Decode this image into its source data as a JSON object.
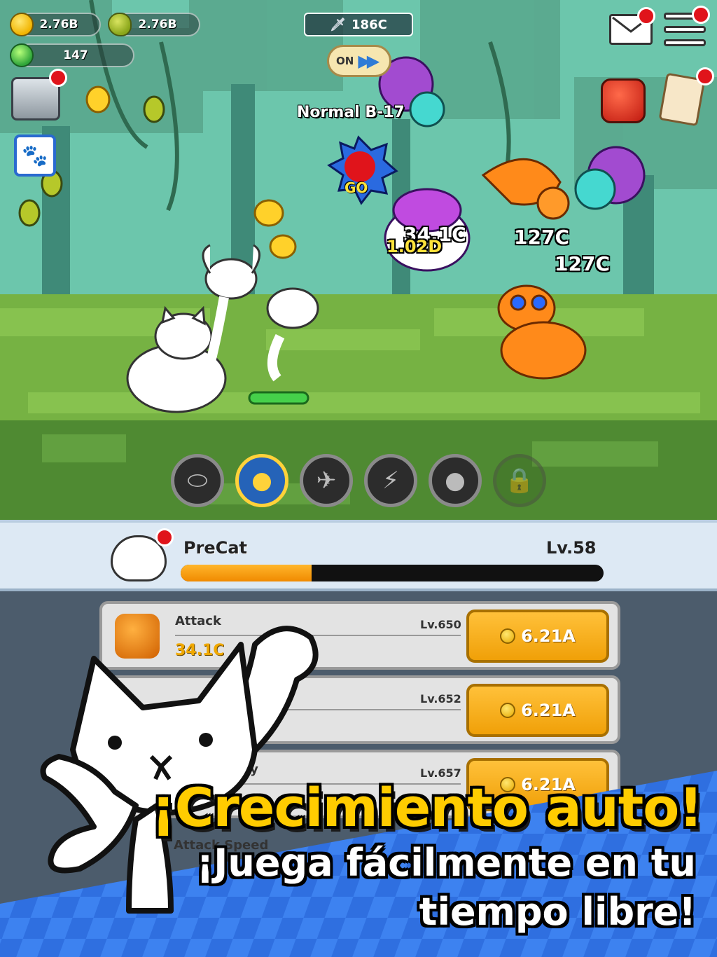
{
  "hud": {
    "coins": "2.76B",
    "mangoes": "2.76B",
    "gems": "147",
    "stage_power": "186C",
    "auto_label": "ON"
  },
  "battle": {
    "stage_name": "Normal B-17",
    "go_label": "GO",
    "damage_numbers": [
      "34.1C",
      "1.02D",
      "127C",
      "127C"
    ]
  },
  "skills": [
    {
      "icon": "paw-shield-icon",
      "state": "idle"
    },
    {
      "icon": "coin-stack-icon",
      "state": "active"
    },
    {
      "icon": "bird-icon",
      "state": "idle"
    },
    {
      "icon": "lightning-icon",
      "state": "idle"
    },
    {
      "icon": "rock-icon",
      "state": "idle"
    },
    {
      "icon": "lock-icon",
      "state": "locked"
    }
  ],
  "cat": {
    "name": "PreCat",
    "level": "Lv.58",
    "xp_progress": 0.31
  },
  "upgrades": [
    {
      "label": "Attack",
      "level": "Lv.650",
      "value": "34.1C",
      "cost": "6.21A"
    },
    {
      "label": "",
      "level": "Lv.652",
      "value": "",
      "cost": "6.21A"
    },
    {
      "label": "ery",
      "level": "Lv.657",
      "value": "",
      "cost": "6.21A"
    }
  ],
  "attack_speed_label": "Attack Speed",
  "promo": {
    "headline": "¡Crecimiento auto!",
    "subline1": "¡Juega fácilmente en tu",
    "subline2": "tiempo libre!"
  },
  "colors": {
    "accent_orange": "#f0a008",
    "headline_yellow": "#ffcc00",
    "alert_red": "#e0141b",
    "promo_blue": "#2f6fe0"
  }
}
